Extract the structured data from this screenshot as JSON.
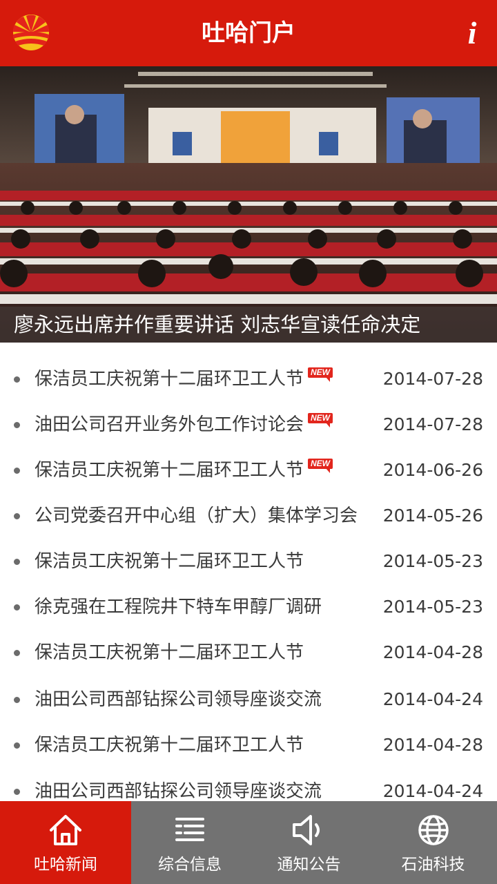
{
  "header": {
    "title": "吐哈门户",
    "info_icon": "i",
    "logo_icon": "petrochina-logo-icon",
    "bg_color": "#d61a0c"
  },
  "banner": {
    "caption": "廖永远出席并作重要讲话 刘志华宣读任命决定"
  },
  "news": {
    "badge_label": "NEW",
    "items": [
      {
        "title": "保洁员工庆祝第十二届环卫工人节",
        "date": "2014-07-28",
        "is_new": true
      },
      {
        "title": "油田公司召开业务外包工作讨论会",
        "date": "2014-07-28",
        "is_new": true
      },
      {
        "title": "保洁员工庆祝第十二届环卫工人节",
        "date": "2014-06-26",
        "is_new": true
      },
      {
        "title": "公司党委召开中心组（扩大）集体学习会",
        "date": "2014-05-26",
        "is_new": false
      },
      {
        "title": "保洁员工庆祝第十二届环卫工人节",
        "date": "2014-05-23",
        "is_new": false
      },
      {
        "title": "徐克强在工程院井下特车甲醇厂调研",
        "date": "2014-05-23",
        "is_new": false
      },
      {
        "title": "保洁员工庆祝第十二届环卫工人节",
        "date": "2014-04-28",
        "is_new": false
      },
      {
        "title": "油田公司西部钻探公司领导座谈交流",
        "date": "2014-04-24",
        "is_new": false
      },
      {
        "title": "保洁员工庆祝第十二届环卫工人节",
        "date": "2014-04-28",
        "is_new": false
      },
      {
        "title": "油田公司西部钻探公司领导座谈交流",
        "date": "2014-04-24",
        "is_new": false
      }
    ]
  },
  "tabs": [
    {
      "label": "吐哈新闻",
      "icon": "home-icon",
      "active": true
    },
    {
      "label": "综合信息",
      "icon": "list-icon",
      "active": false
    },
    {
      "label": "通知公告",
      "icon": "speaker-icon",
      "active": false
    },
    {
      "label": "石油科技",
      "icon": "globe-icon",
      "active": false
    }
  ]
}
